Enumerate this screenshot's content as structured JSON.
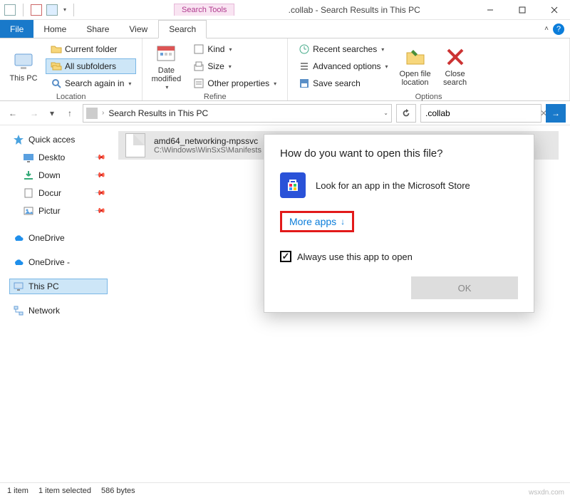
{
  "window": {
    "search_tools_tab": "Search Tools",
    "title": ".collab - Search Results in This PC"
  },
  "tabs": {
    "file": "File",
    "home": "Home",
    "share": "Share",
    "view": "View",
    "search": "Search"
  },
  "ribbon": {
    "location": {
      "this_pc": "This PC",
      "current_folder": "Current folder",
      "all_subfolders": "All subfolders",
      "search_again_in": "Search again in",
      "label": "Location"
    },
    "refine": {
      "date_modified": "Date modified",
      "kind": "Kind",
      "size": "Size",
      "other_properties": "Other properties",
      "label": "Refine"
    },
    "options": {
      "recent_searches": "Recent searches",
      "advanced_options": "Advanced options",
      "save_search": "Save search",
      "open_file_location": "Open file location",
      "close_search": "Close search",
      "label": "Options"
    }
  },
  "address": {
    "text": "Search Results in This PC"
  },
  "search_input": {
    "value": ".collab"
  },
  "sidebar": {
    "quick_access": "Quick acces",
    "desktop": "Deskto",
    "downloads": "Down",
    "documents": "Docur",
    "pictures": "Pictur",
    "onedrive": "OneDrive",
    "onedrive2": "OneDrive -",
    "this_pc": "This PC",
    "network": "Network"
  },
  "result": {
    "name": "amd64_networking-mpssvc",
    "path": "C:\\Windows\\WinSxS\\Manifests"
  },
  "dialog": {
    "title": "How do you want to open this file?",
    "store_option": "Look for an app in the Microsoft Store",
    "more_apps": "More apps",
    "always_use": "Always use this app to open",
    "ok": "OK"
  },
  "status": {
    "item_count": "1 item",
    "selected": "1 item selected",
    "size": "586 bytes"
  },
  "watermark": "wsxdn.com"
}
